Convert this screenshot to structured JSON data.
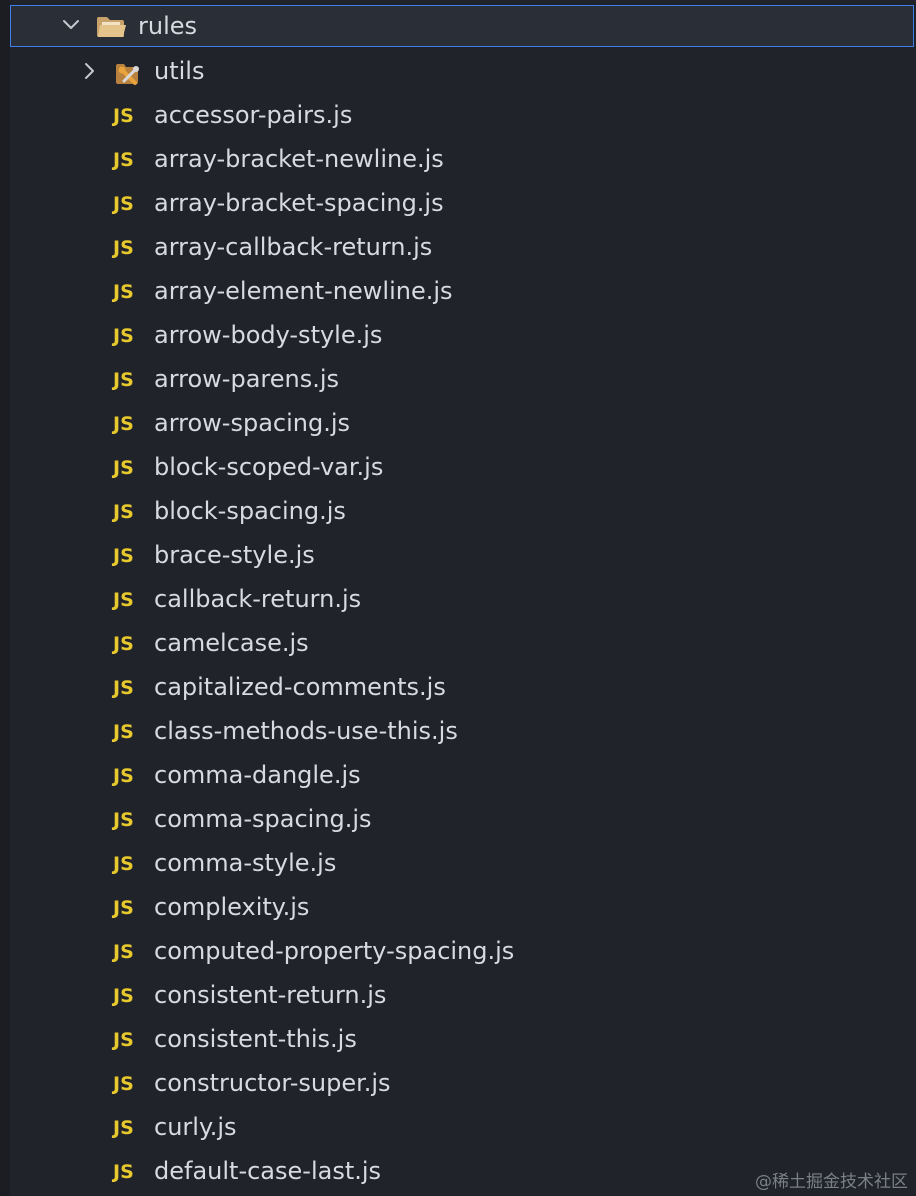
{
  "root_folder": {
    "name": "rules",
    "expanded": true,
    "chevron": "chevron-down-icon",
    "icon": "folder-open-icon"
  },
  "child_folder": {
    "name": "utils",
    "expanded": false,
    "chevron": "chevron-right-icon",
    "icon": "tools-folder-icon"
  },
  "files": [
    {
      "badge": "JS",
      "name": "accessor-pairs.js"
    },
    {
      "badge": "JS",
      "name": "array-bracket-newline.js"
    },
    {
      "badge": "JS",
      "name": "array-bracket-spacing.js"
    },
    {
      "badge": "JS",
      "name": "array-callback-return.js"
    },
    {
      "badge": "JS",
      "name": "array-element-newline.js"
    },
    {
      "badge": "JS",
      "name": "arrow-body-style.js"
    },
    {
      "badge": "JS",
      "name": "arrow-parens.js"
    },
    {
      "badge": "JS",
      "name": "arrow-spacing.js"
    },
    {
      "badge": "JS",
      "name": "block-scoped-var.js"
    },
    {
      "badge": "JS",
      "name": "block-spacing.js"
    },
    {
      "badge": "JS",
      "name": "brace-style.js"
    },
    {
      "badge": "JS",
      "name": "callback-return.js"
    },
    {
      "badge": "JS",
      "name": "camelcase.js"
    },
    {
      "badge": "JS",
      "name": "capitalized-comments.js"
    },
    {
      "badge": "JS",
      "name": "class-methods-use-this.js"
    },
    {
      "badge": "JS",
      "name": "comma-dangle.js"
    },
    {
      "badge": "JS",
      "name": "comma-spacing.js"
    },
    {
      "badge": "JS",
      "name": "comma-style.js"
    },
    {
      "badge": "JS",
      "name": "complexity.js"
    },
    {
      "badge": "JS",
      "name": "computed-property-spacing.js"
    },
    {
      "badge": "JS",
      "name": "consistent-return.js"
    },
    {
      "badge": "JS",
      "name": "consistent-this.js"
    },
    {
      "badge": "JS",
      "name": "constructor-super.js"
    },
    {
      "badge": "JS",
      "name": "curly.js"
    },
    {
      "badge": "JS",
      "name": "default-case-last.js"
    }
  ],
  "watermark": "@稀土掘金技术社区",
  "colors": {
    "background": "#20232a",
    "selection_border": "#3f7ee8",
    "js_badge": "#e8c92d",
    "text": "#d7dae0"
  }
}
